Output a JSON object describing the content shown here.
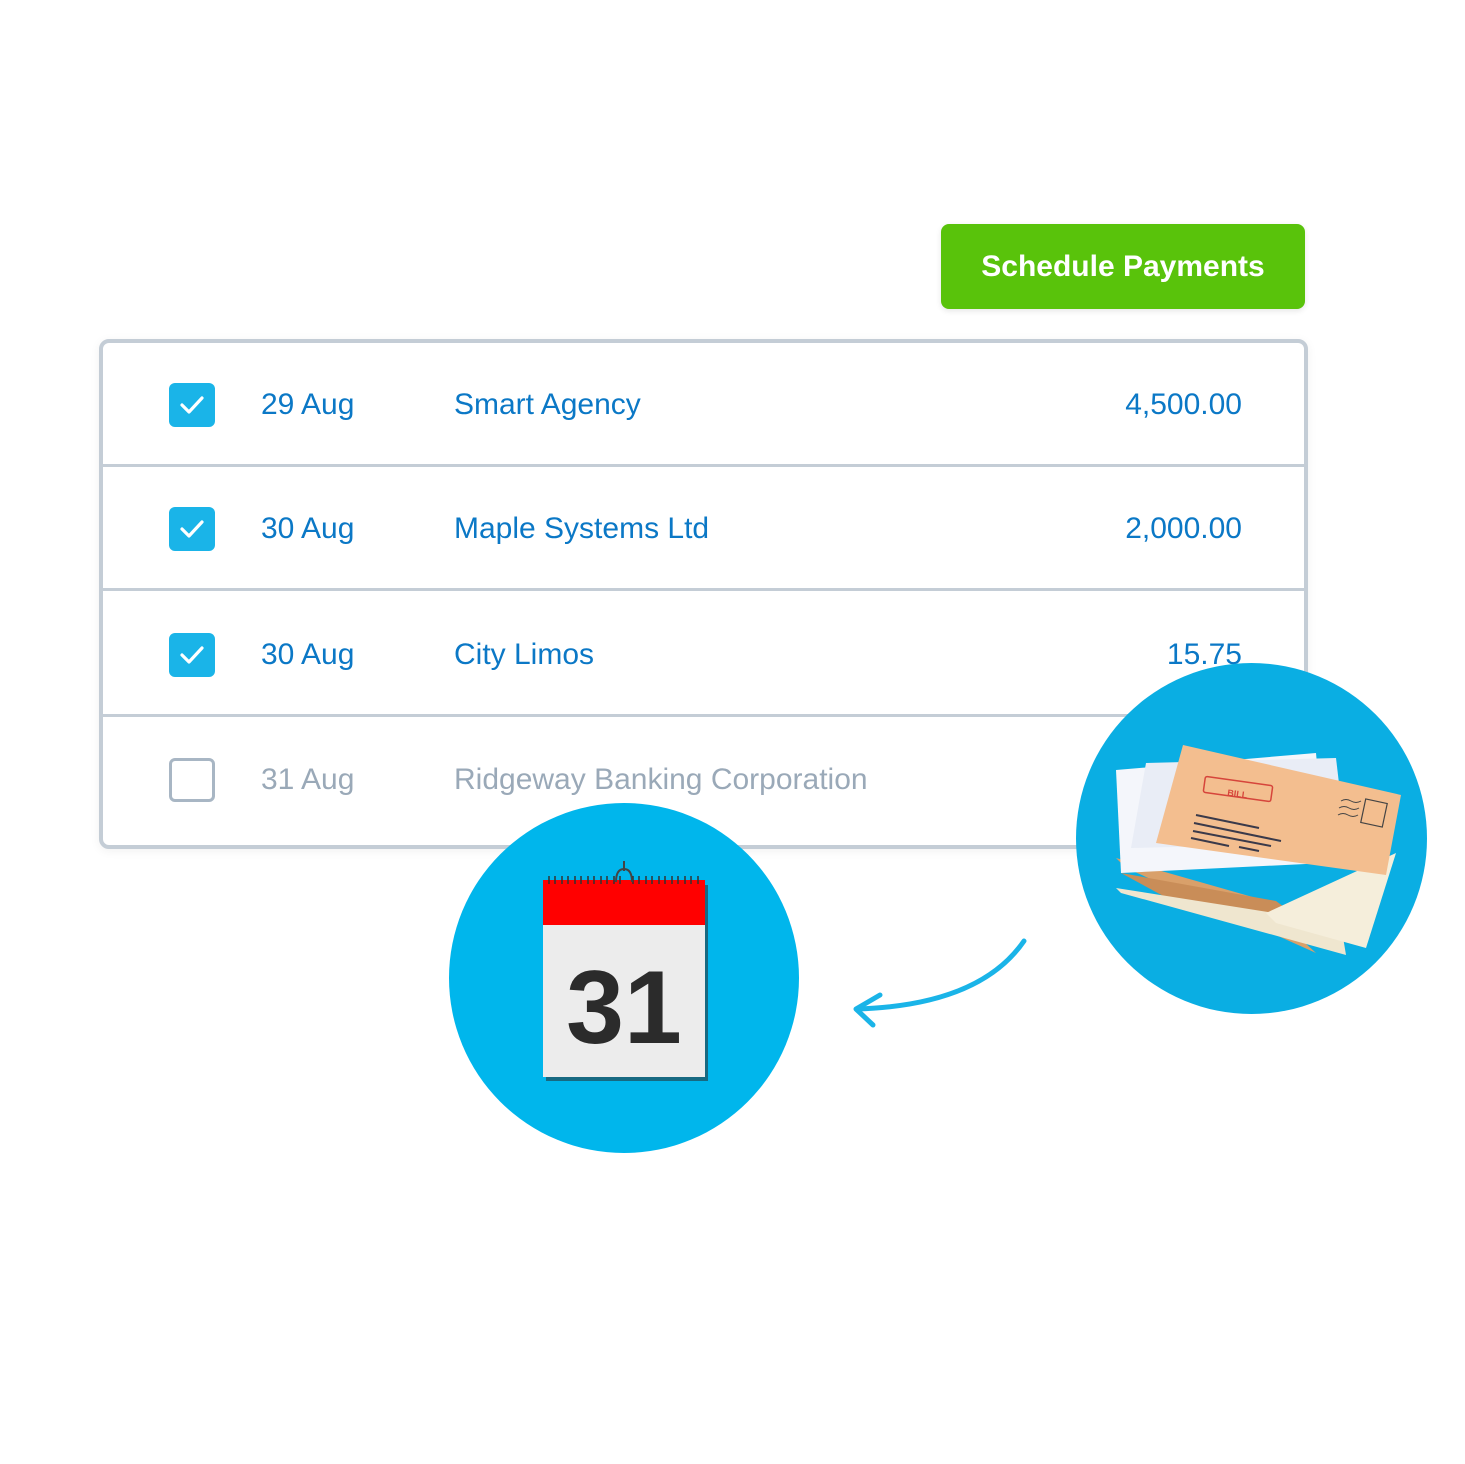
{
  "toolbar": {
    "schedule_label": "Schedule Payments",
    "accent_color": "#59c30b"
  },
  "bills": [
    {
      "checked": true,
      "date": "29 Aug",
      "payee": "Smart Agency",
      "amount": "4,500.00"
    },
    {
      "checked": true,
      "date": "30 Aug",
      "payee": "Maple Systems Ltd",
      "amount": "2,000.00"
    },
    {
      "checked": true,
      "date": "30 Aug",
      "payee": "City Limos",
      "amount": "15.75"
    },
    {
      "checked": false,
      "date": "31 Aug",
      "payee": "Ridgeway Banking Corporation",
      "amount": ""
    }
  ],
  "illustrations": {
    "calendar": {
      "icon": "calendar-icon",
      "day": "31"
    },
    "bills": {
      "icon": "envelopes-icon",
      "stamp_label": "BILL"
    },
    "arrow": {
      "icon": "curved-arrow-left-icon"
    }
  },
  "colors": {
    "link_blue": "#0b78c6",
    "checkbox_blue": "#1ab4e8",
    "muted_text": "#9aa9b8",
    "circle_blue": "#00b6ec"
  }
}
